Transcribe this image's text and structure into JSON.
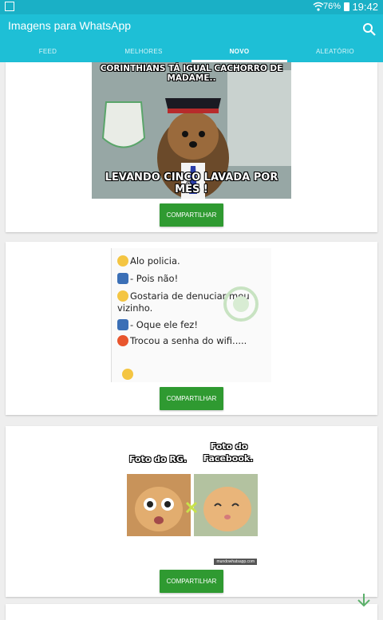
{
  "status": {
    "battery": "76%",
    "time": "19:42"
  },
  "app": {
    "title": "Imagens para WhatsApp"
  },
  "tabs": [
    {
      "label": "FEED"
    },
    {
      "label": "MELHORES"
    },
    {
      "label": "NOVO"
    },
    {
      "label": "ALEATÓRIO"
    }
  ],
  "active_tab": "NOVO",
  "posts": [
    {
      "caption_top": "CORINTHIANS TÁ IGUAL CACHORRO DE MADAME..",
      "caption_bottom": "LEVANDO CINCO LAVADA POR MÊS !",
      "share_label": "COMPARTILHAR"
    },
    {
      "chat": [
        "Alo policia.",
        "- Pois não!",
        "Gostaria de denuciar meu",
        "vizinho.",
        "- Oque ele fez!",
        "Trocou a senha do wifi....."
      ],
      "share_label": "COMPARTILHAR"
    },
    {
      "label_left": "Foto do RG.",
      "label_right_1": "Foto do",
      "label_right_2": "Facebook.",
      "watermark": "mundowhatsapp.com",
      "share_label": "COMPARTILHAR"
    }
  ],
  "icons": {
    "search": "search-icon",
    "scroll": "arrow-down-icon",
    "accent": "#1ebfd6",
    "button": "#2f9a31"
  }
}
